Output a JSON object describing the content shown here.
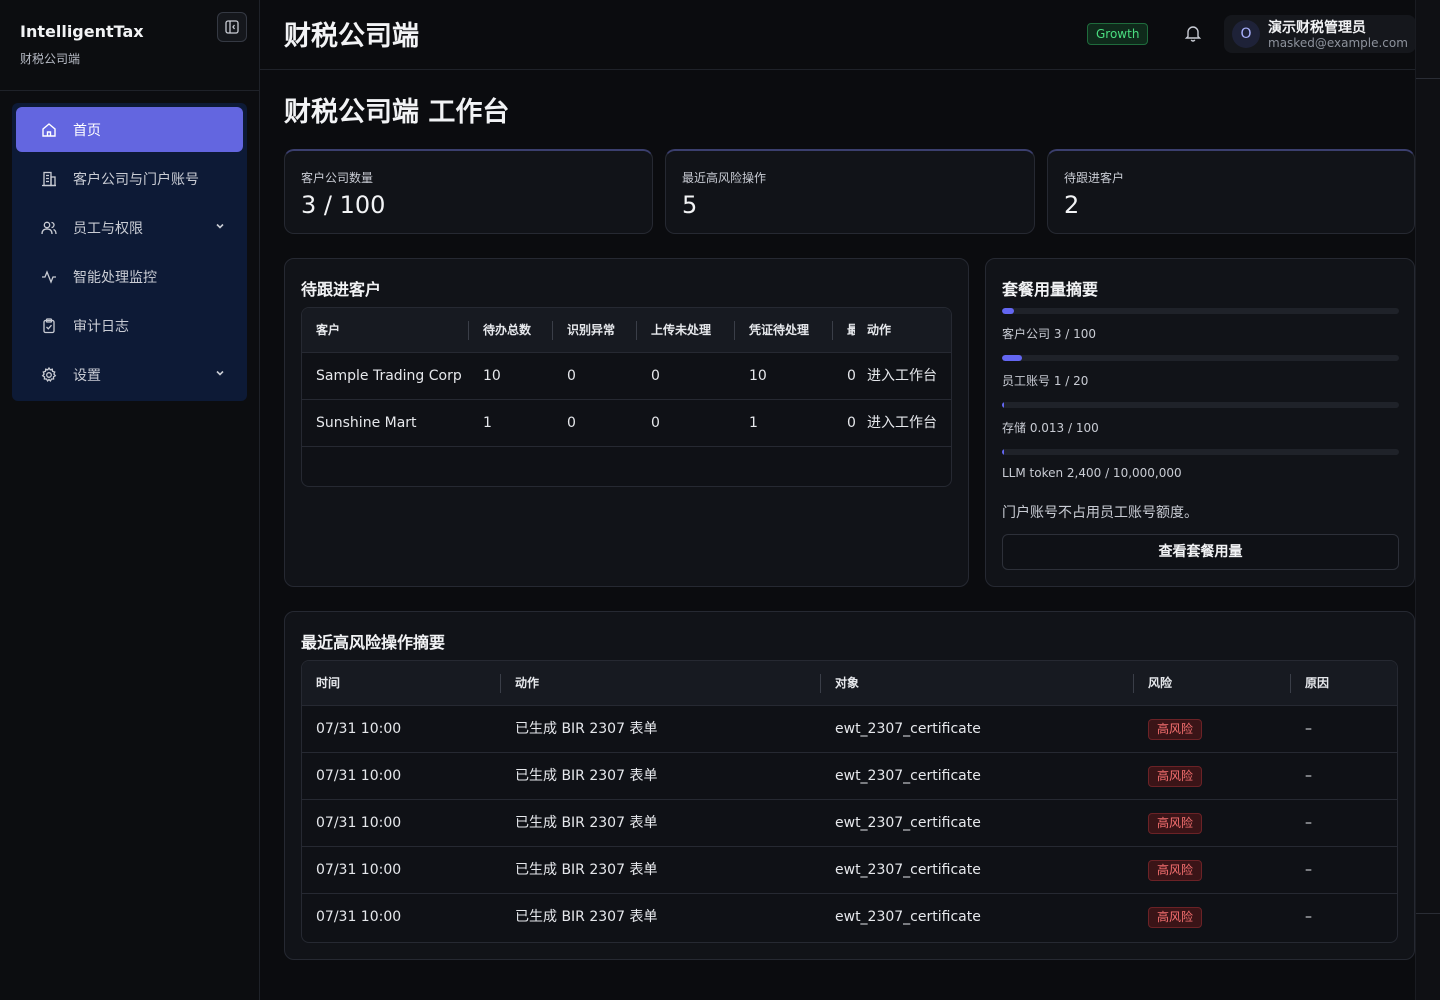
{
  "brand": {
    "name": "IntelligentTax",
    "subtitle": "财税公司端"
  },
  "sidebar": {
    "items": [
      {
        "label": "首页",
        "icon": "home-icon",
        "active": true
      },
      {
        "label": "客户公司与门户账号",
        "icon": "building-icon"
      },
      {
        "label": "员工与权限",
        "icon": "users-icon",
        "expandable": true
      },
      {
        "label": "智能处理监控",
        "icon": "activity-icon"
      },
      {
        "label": "审计日志",
        "icon": "clipboard-check-icon"
      },
      {
        "label": "设置",
        "icon": "gear-icon",
        "expandable": true
      }
    ]
  },
  "header": {
    "title": "财税公司端",
    "plan": "Growth",
    "user": {
      "initial": "O",
      "name": "演示财税管理员",
      "email": "masked@example.com"
    }
  },
  "page": {
    "title": "财税公司端 工作台"
  },
  "stats": [
    {
      "label": "客户公司数量",
      "value": "3 / 100"
    },
    {
      "label": "最近高风险操作",
      "value": "5"
    },
    {
      "label": "待跟进客户",
      "value": "2"
    }
  ],
  "followup": {
    "title": "待跟进客户",
    "columns": [
      "客户",
      "待办总数",
      "识别异常",
      "上传未处理",
      "凭证待处理",
      "最",
      "动作"
    ],
    "rows": [
      {
        "customer": "Sample Trading Corp",
        "total": "10",
        "anomaly": "0",
        "uploaded": "0",
        "voucher": "10",
        "last": "0",
        "action": "进入工作台"
      },
      {
        "customer": "Sunshine Mart",
        "total": "1",
        "anomaly": "0",
        "uploaded": "0",
        "voucher": "1",
        "last": "0",
        "action": "进入工作台"
      }
    ]
  },
  "usage": {
    "title": "套餐用量摘要",
    "items": [
      {
        "label": "客户公司 3 / 100",
        "fraction": 0.03
      },
      {
        "label": "员工账号 1 / 20",
        "fraction": 0.05
      },
      {
        "label": "存储 0.013 / 100",
        "fraction": 0.00013
      },
      {
        "label": "LLM token 2,400 / 10,000,000",
        "fraction": 0.00024
      }
    ],
    "note": "门户账号不占用员工账号额度。",
    "button": "查看套餐用量"
  },
  "risk": {
    "title": "最近高风险操作摘要",
    "columns": [
      "时间",
      "动作",
      "对象",
      "风险",
      "原因"
    ],
    "rows": [
      {
        "time": "07/31 10:00",
        "action": "已生成 BIR 2307 表单",
        "object": "ewt_2307_certificate",
        "risk": "高风险",
        "reason": "–"
      },
      {
        "time": "07/31 10:00",
        "action": "已生成 BIR 2307 表单",
        "object": "ewt_2307_certificate",
        "risk": "高风险",
        "reason": "–"
      },
      {
        "time": "07/31 10:00",
        "action": "已生成 BIR 2307 表单",
        "object": "ewt_2307_certificate",
        "risk": "高风险",
        "reason": "–"
      },
      {
        "time": "07/31 10:00",
        "action": "已生成 BIR 2307 表单",
        "object": "ewt_2307_certificate",
        "risk": "高风险",
        "reason": "–"
      },
      {
        "time": "07/31 10:00",
        "action": "已生成 BIR 2307 表单",
        "object": "ewt_2307_certificate",
        "risk": "高风险",
        "reason": "–"
      }
    ]
  },
  "colors": {
    "accent": "#6366e0",
    "success": "#4ade80",
    "danger": "#f87171",
    "background": "#0b0c0f"
  }
}
